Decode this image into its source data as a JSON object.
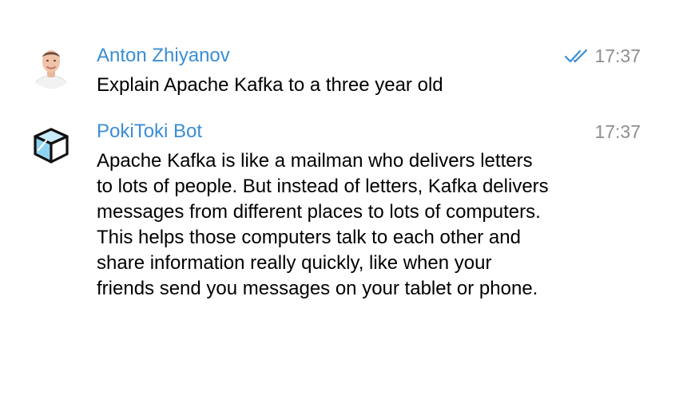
{
  "messages": [
    {
      "sender": "Anton Zhiyanov",
      "text": "Explain Apache Kafka to a three year old",
      "time": "17:37",
      "avatar": "user-photo-avatar",
      "status": "read-double-check-icon"
    },
    {
      "sender": "PokiToki Bot",
      "text": "Apache Kafka is like a mailman who delivers letters to lots of people. But instead of letters, Kafka delivers messages from different places to lots of computers. This helps those computers talk to each other and share information really quickly, like when your friends send you messages on your tablet or phone.",
      "time": "17:37",
      "avatar": "cube-icon"
    }
  ],
  "colors": {
    "sender_name": "#3a8ed4",
    "timestamp": "#8e8e93",
    "check_mark": "#3a8ed4",
    "cube_face": "#8fd3f2"
  }
}
